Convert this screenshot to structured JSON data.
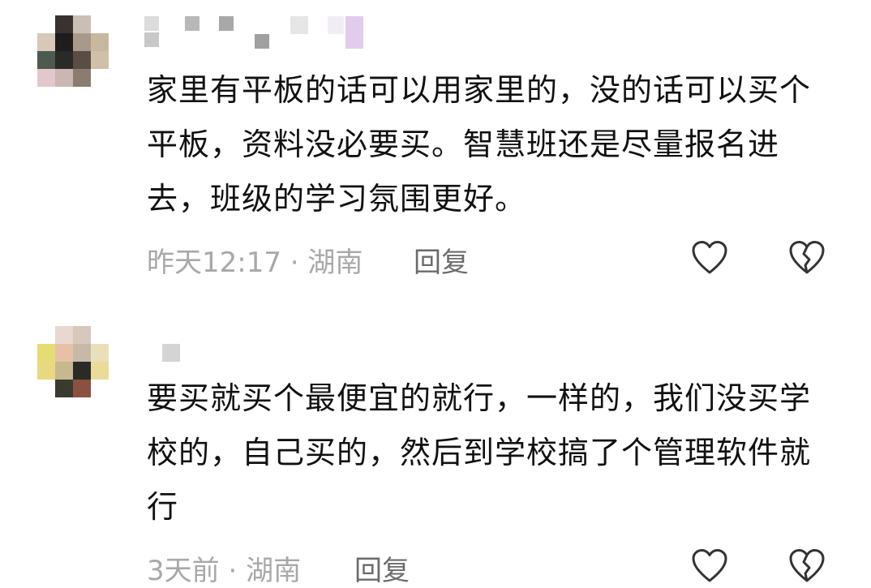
{
  "comments": [
    {
      "body": "家里有平板的话可以用家里的，没的话可以买个平板，资料没必要买。智慧班还是尽量报名进去，班级的学习氛围更好。",
      "time": "昨天12:17",
      "separator": " · ",
      "location": "湖南",
      "reply_label": "回复",
      "avatar_colors": [
        "#ffffff",
        "#3a3230",
        "#c9bfb4",
        "#ffffff",
        "#d8c8b8",
        "#1e1c1c",
        "#a89a8a",
        "#c8b8a0",
        "#4e5a50",
        "#2a2a26",
        "#5a4e44",
        "#d0c0a8",
        "#e2c8cc",
        "#cbb6b2",
        "#8a7c70",
        "#ffffff"
      ]
    },
    {
      "body": "要买就买个最便宜的就行，一样的，我们没买学校的，自己买的，然后到学校搞了个管理软件就行",
      "time": "3天前",
      "separator": " · ",
      "location": "湖南",
      "reply_label": "回复",
      "avatar_colors": [
        "#ffffff",
        "#e8d8d0",
        "#d8c8bc",
        "#ffffff",
        "#e6dc74",
        "#e8c0a8",
        "#c8b8a8",
        "#e8e0b8",
        "#e8d880",
        "#c8b890",
        "#2a2a26",
        "#e8dc98",
        "#ffffff",
        "#3a3a30",
        "#8a5040",
        "#ffffff"
      ]
    }
  ],
  "icons": {
    "like": "heart-outline-icon",
    "dislike": "broken-heart-outline-icon"
  },
  "colors": {
    "body_text": "#111111",
    "meta_text": "#a8a8a8",
    "reply_text": "#6b6b6b",
    "icon_stroke": "#333333"
  }
}
